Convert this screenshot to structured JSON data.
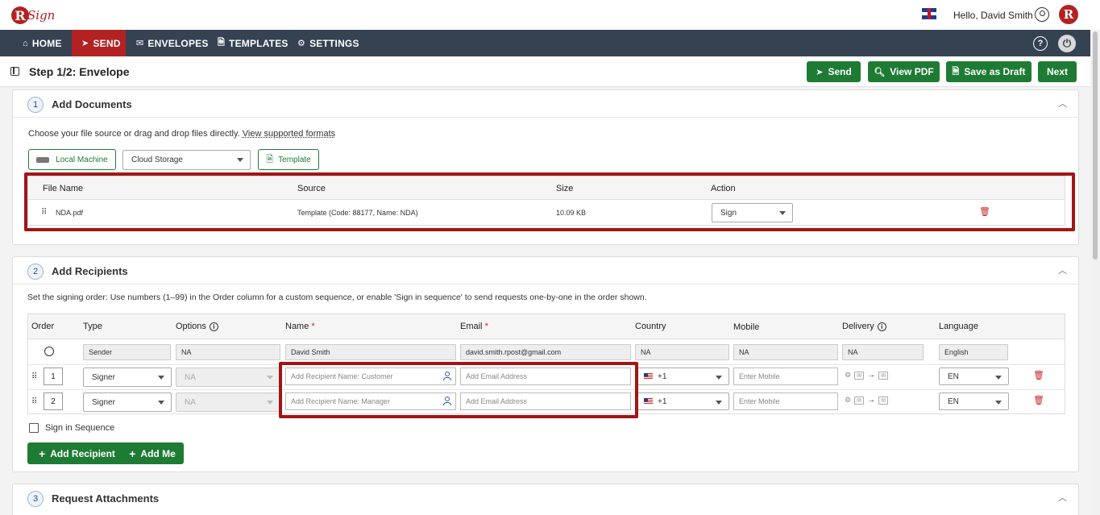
{
  "header": {
    "logo_mark": "R",
    "logo_text": "Sign",
    "greeting": "Hello, David Smith",
    "brand_mark": "R",
    "flag_icon": "uk-flag-icon",
    "user_icon": "user-circle-icon"
  },
  "nav": {
    "items": [
      {
        "label": "HOME",
        "icon": "⌂"
      },
      {
        "label": "SEND",
        "icon": "➤"
      },
      {
        "label": "ENVELOPES",
        "icon": "✉"
      },
      {
        "label": "TEMPLATES",
        "icon": "🗎"
      },
      {
        "label": "SETTINGS",
        "icon": "⚙"
      }
    ],
    "help_glyph": "?",
    "power_glyph": "⏻"
  },
  "stepbar": {
    "title": "Step 1/2: Envelope",
    "buttons": {
      "send": "Send",
      "view_pdf": "View PDF",
      "save_draft": "Save as Draft",
      "next": "Next"
    }
  },
  "documents": {
    "number": "1",
    "title": "Add Documents",
    "instructions": "Choose your file source or drag and drop files directly.",
    "formats_link": "View supported formats",
    "local_machine": "Local Machine",
    "cloud_storage": "Cloud Storage",
    "template": "Template",
    "columns": [
      "File Name",
      "Source",
      "Size",
      "Action"
    ],
    "rows": [
      {
        "file_name": "NDA.pdf",
        "source": "Template (Code: 88177, Name: NDA)",
        "size": "10.09 KB",
        "action": "Sign"
      }
    ]
  },
  "recipients": {
    "number": "2",
    "title": "Add Recipients",
    "instructions": "Set the signing order: Use numbers (1–99) in the Order column for a custom sequence, or enable 'Sign in sequence' to send requests one-by-one in the order shown.",
    "columns": {
      "order": "Order",
      "type": "Type",
      "options": "Options",
      "name": "Name",
      "email": "Email",
      "country": "Country",
      "mobile": "Mobile",
      "delivery": "Delivery",
      "language": "Language"
    },
    "required_mark": "*",
    "sender": {
      "type": "Sender",
      "options": "NA",
      "name": "David Smith",
      "email": "david.smith.rpost@gmail.com",
      "country": "NA",
      "mobile": "NA",
      "delivery": "NA",
      "language": "English"
    },
    "rows": [
      {
        "order": "1",
        "type": "Signer",
        "options": "NA",
        "name_placeholder": "Add Recipient Name: Customer",
        "email_placeholder": "Add Email Address",
        "country_code": "+1",
        "mobile_placeholder": "Enter Mobile",
        "language": "EN"
      },
      {
        "order": "2",
        "type": "Signer",
        "options": "NA",
        "name_placeholder": "Add Recipient Name: Manager",
        "email_placeholder": "Add Email Address",
        "country_code": "+1",
        "mobile_placeholder": "Enter Mobile",
        "language": "EN"
      }
    ],
    "sign_in_sequence": "Sign in Sequence",
    "add_recipient": "Add Recipient",
    "add_me": "Add Me"
  },
  "attachments": {
    "number": "3",
    "title": "Request Attachments"
  },
  "colors": {
    "nav_bg": "#354252",
    "active": "#b22222",
    "green": "#1e7b34",
    "highlight": "#a31515"
  }
}
